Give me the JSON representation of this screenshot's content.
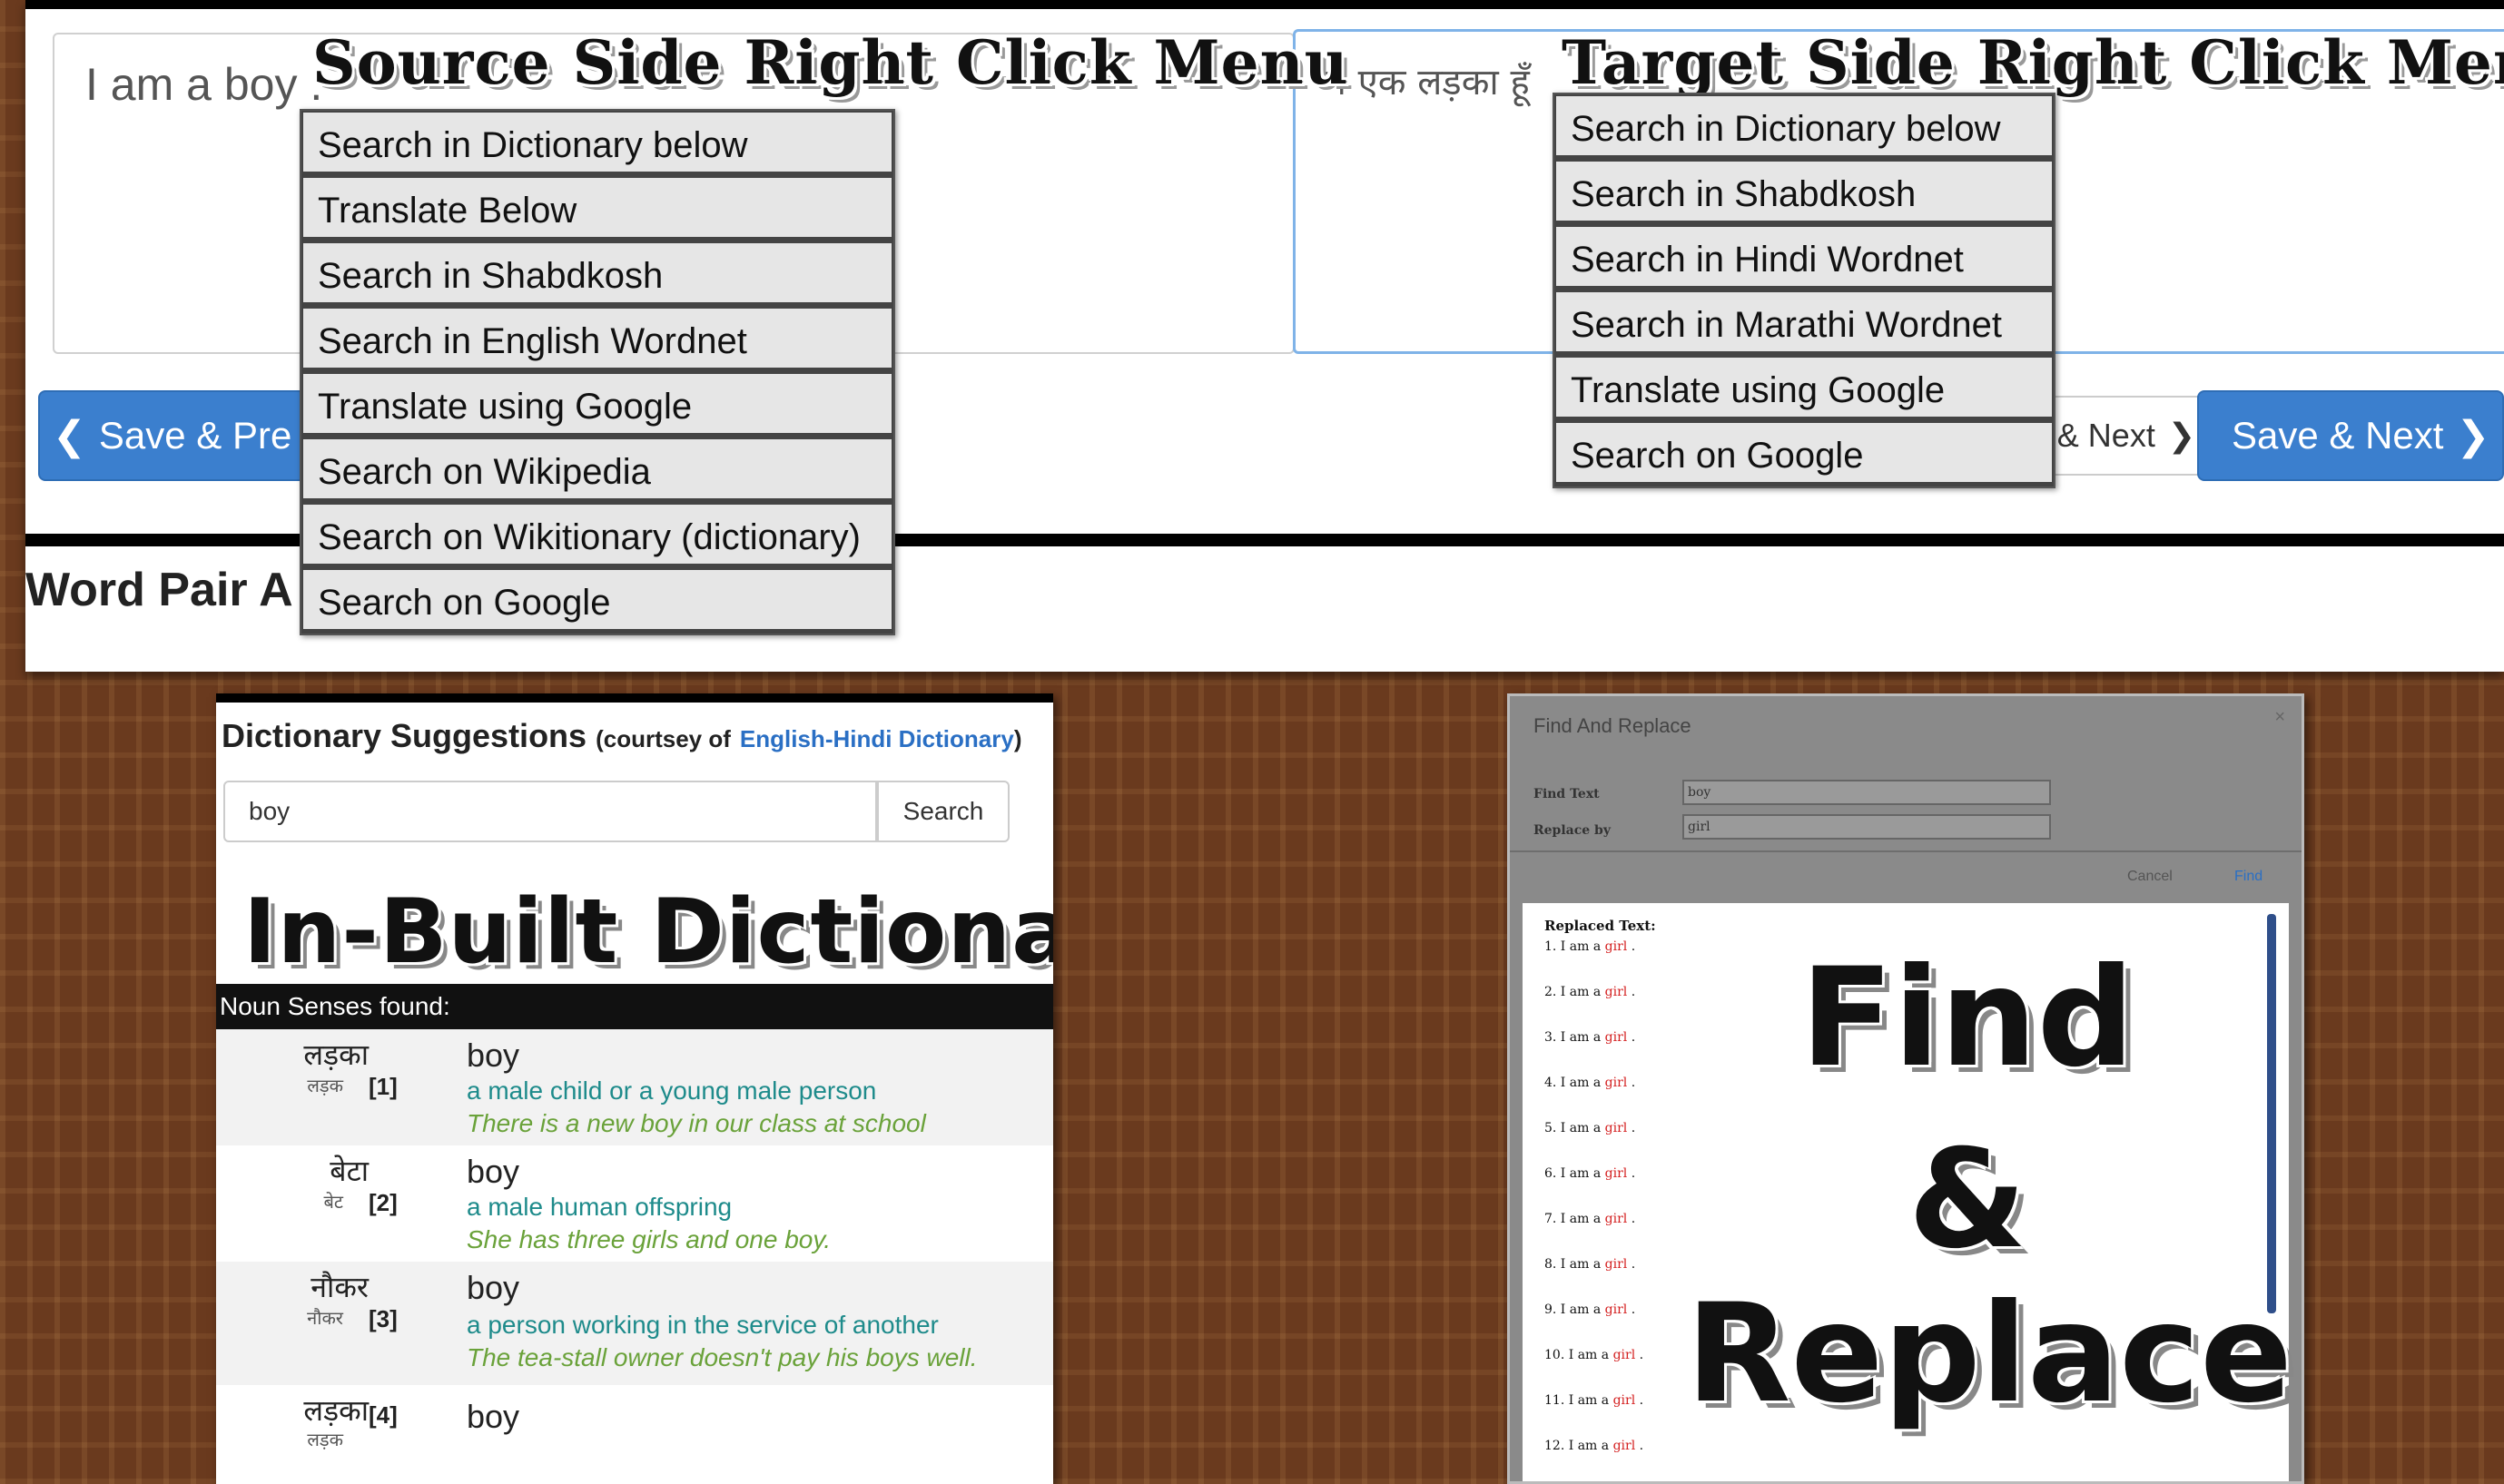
{
  "source": {
    "text": "I am a boy .",
    "overlay_title": "Source Side Right Click Menu",
    "menu": [
      "Search in Dictionary below",
      "Translate Below",
      "Search in Shabdkosh",
      "Search in English Wordnet",
      "Translate using Google",
      "Search on Wikipedia",
      "Search on Wikitionary (dictionary)",
      "Search on Google"
    ]
  },
  "target": {
    "text": "मैं एक लड़का हूँ",
    "overlay_title": "Target Side Right Click Menu",
    "menu": [
      "Search in Dictionary below",
      "Search in Shabdkosh",
      "Search in Hindi Wordnet",
      "Search in Marathi Wordnet",
      "Translate using Google",
      "Search on Google"
    ]
  },
  "buttons": {
    "save_prev": "Save & Pre",
    "next": "& Next",
    "save_next": "Save & Next"
  },
  "word_pair_heading": "Word Pair A",
  "dictionary": {
    "heading": "Dictionary Suggestions",
    "courtesy_prefix": "(courtsey of",
    "courtesy_link": "English-Hindi Dictionary",
    "courtesy_suffix": ")",
    "search_value": "boy",
    "search_button": "Search",
    "overlay_title": "In-Built Dictionary",
    "noun_bar": "Noun Senses found:",
    "senses": [
      {
        "hindi": "लड़का",
        "root": "लड़क",
        "num": "[1]",
        "word": "boy",
        "definition": "a male child or a young male person",
        "example": "There is a new boy in our class at school"
      },
      {
        "hindi": "बेटा",
        "root": "बेट",
        "num": "[2]",
        "word": "boy",
        "definition": "a male human offspring",
        "example": "She has three girls and one boy."
      },
      {
        "hindi": "नौकर",
        "root": "नौकर",
        "num": "[3]",
        "word": "boy",
        "definition": "a person working in the service of another",
        "example": "The tea-stall owner doesn't pay his boys well."
      },
      {
        "hindi": "लड़का",
        "root": "लड़क",
        "num": "[4]",
        "word": "boy",
        "definition": "",
        "example": ""
      }
    ]
  },
  "find_replace": {
    "title": "Find And Replace",
    "close": "×",
    "find_label": "Find Text",
    "find_value": "boy",
    "replace_label": "Replace by",
    "replace_value": "girl",
    "cancel": "Cancel",
    "find": "Find",
    "replaced_title": "Replaced Text:",
    "line_prefix": "I am a",
    "line_word": "girl",
    "line_suffix": ".",
    "line_numbers": [
      "1.",
      "2.",
      "3.",
      "4.",
      "5.",
      "6.",
      "7.",
      "8.",
      "9.",
      "10.",
      "11.",
      "12."
    ],
    "overlay_line1": "Find",
    "overlay_line2": "&",
    "overlay_line3": "Replace"
  }
}
